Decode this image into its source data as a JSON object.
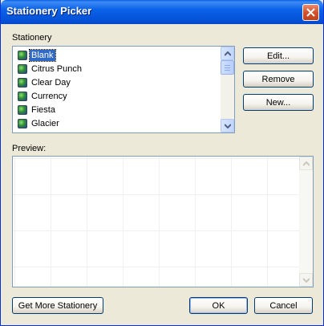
{
  "window": {
    "title": "Stationery Picker"
  },
  "stationery": {
    "label": "Stationery",
    "items": [
      {
        "label": "Blank",
        "selected": true
      },
      {
        "label": "Citrus Punch",
        "selected": false
      },
      {
        "label": "Clear Day",
        "selected": false
      },
      {
        "label": "Currency",
        "selected": false
      },
      {
        "label": "Fiesta",
        "selected": false
      },
      {
        "label": "Glacier",
        "selected": false
      }
    ]
  },
  "buttons": {
    "edit": "Edit...",
    "remove": "Remove",
    "new": "New...",
    "get_more": "Get More Stationery",
    "ok": "OK",
    "cancel": "Cancel"
  },
  "preview": {
    "label": "Preview:"
  },
  "colors": {
    "selection": "#316ac5",
    "titlebar": "#0553d9",
    "face": "#ece9d8"
  },
  "icons": [
    "close-icon",
    "stationery-item-icon",
    "scroll-up-icon",
    "scroll-down-icon"
  ]
}
